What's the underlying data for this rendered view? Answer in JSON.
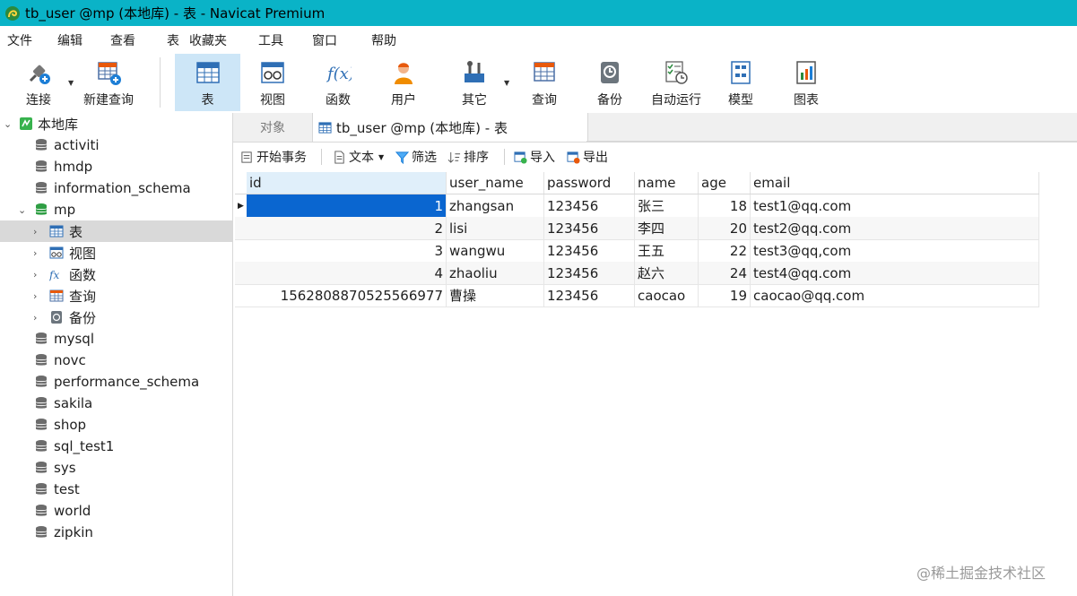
{
  "window": {
    "title": "tb_user @mp (本地库) - 表 - Navicat Premium"
  },
  "menu": [
    "文件",
    "编辑",
    "查看",
    "表",
    "收藏夹",
    "工具",
    "窗口",
    "帮助"
  ],
  "toolbar": {
    "buttons": [
      "连接",
      "新建查询",
      "表",
      "视图",
      "函数",
      "用户",
      "其它",
      "查询",
      "备份",
      "自动运行",
      "模型",
      "图表"
    ],
    "active": "表"
  },
  "sidebar": {
    "connection": "本地库",
    "databases": [
      "activiti",
      "hmdp",
      "information_schema",
      "mp",
      "mysql",
      "novc",
      "performance_schema",
      "sakila",
      "shop",
      "sql_test1",
      "sys",
      "test",
      "world",
      "zipkin"
    ],
    "mp_children": [
      "表",
      "视图",
      "函数",
      "查询",
      "备份"
    ]
  },
  "tabs": {
    "objects": "对象",
    "active": "tb_user @mp (本地库) - 表"
  },
  "data_toolbar": [
    "开始事务",
    "文本",
    "筛选",
    "排序",
    "导入",
    "导出"
  ],
  "grid": {
    "columns": [
      "id",
      "user_name",
      "password",
      "name",
      "age",
      "email"
    ],
    "rows": [
      [
        "1",
        "zhangsan",
        "123456",
        "张三",
        "18",
        "test1@qq.com"
      ],
      [
        "2",
        "lisi",
        "123456",
        "李四",
        "20",
        "test2@qq.com"
      ],
      [
        "3",
        "wangwu",
        "123456",
        "王五",
        "22",
        "test3@qq,com"
      ],
      [
        "4",
        "zhaoliu",
        "123456",
        "赵六",
        "24",
        "test4@qq.com"
      ],
      [
        "1562808870525566977",
        "曹操",
        "123456",
        "caocao",
        "19",
        "caocao@qq.com"
      ]
    ]
  },
  "watermark": "@稀土掘金技术社区",
  "colors": {
    "titlebar": "#0ab3c7",
    "selection": "#0a66d0",
    "active_tool": "#cde6f7"
  }
}
